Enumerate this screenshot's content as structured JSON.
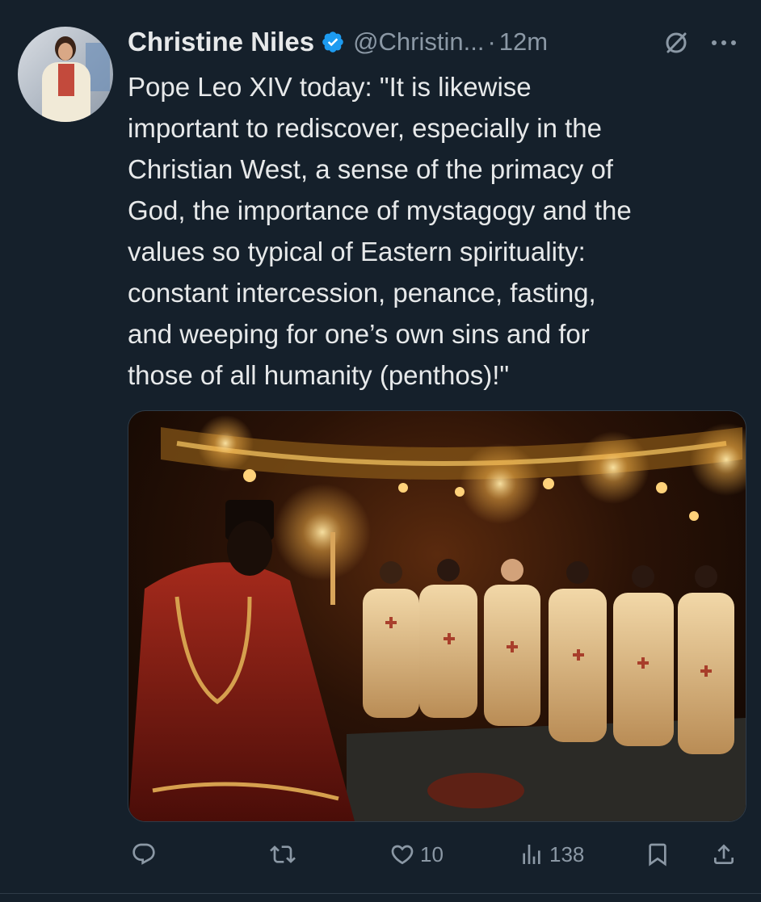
{
  "tweet": {
    "author_name": "Christine Niles",
    "handle": "@Christin...",
    "separator": "·",
    "time": "12m",
    "text": "Pope Leo XIV today: \"It is likewise\nimportant to rediscover, especially in the\nChristian West, a sense of the primacy of\nGod, the importance of mystagogy and the\nvalues so typical of Eastern spirituality:\nconstant intercession, penance, fasting,\nand weeping for one’s own sins and for\nthose of all humanity (penthos)!\""
  },
  "actions": {
    "likes": "10",
    "views": "138"
  },
  "icons": [
    "avatar",
    "verified-badge-icon",
    "mute-icon",
    "more-icon",
    "reply-icon",
    "retweet-icon",
    "like-icon",
    "views-icon",
    "bookmark-icon",
    "share-icon"
  ],
  "colors": {
    "background": "#15202b",
    "text": "#e7e9ea",
    "muted": "#8b98a5",
    "verified": "#1d9bf0"
  }
}
